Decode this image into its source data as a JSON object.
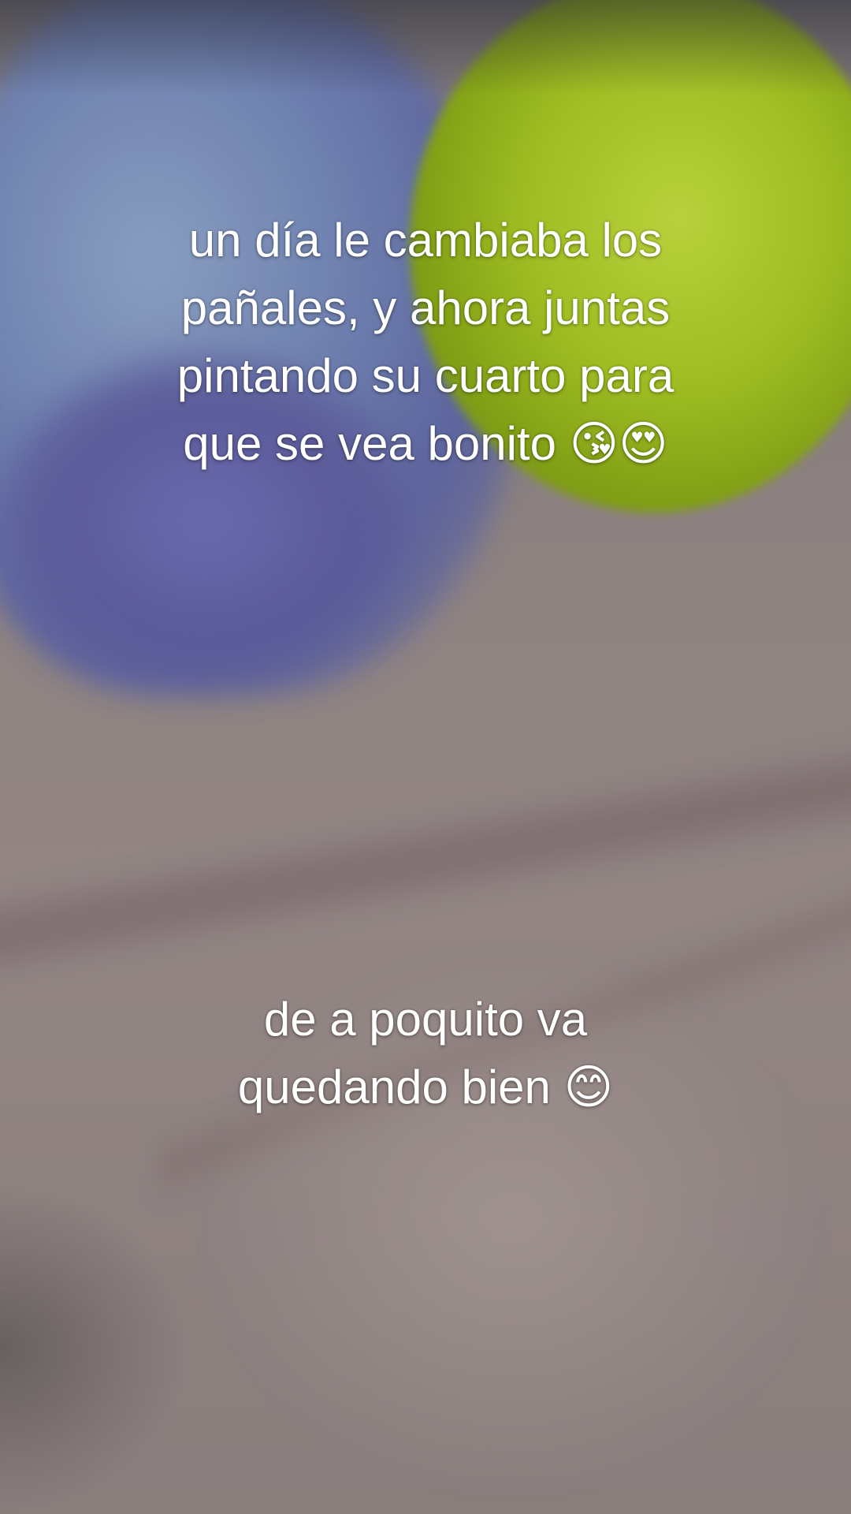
{
  "captions": [
    {
      "lines": [
        "un día le cambiaba los",
        "pañales, y ahora juntas",
        "pintando su cuarto para",
        "que se vea bonito 😘😍"
      ]
    },
    {
      "lines": [
        "de a poquito va",
        "quedando bien 😊"
      ]
    }
  ]
}
